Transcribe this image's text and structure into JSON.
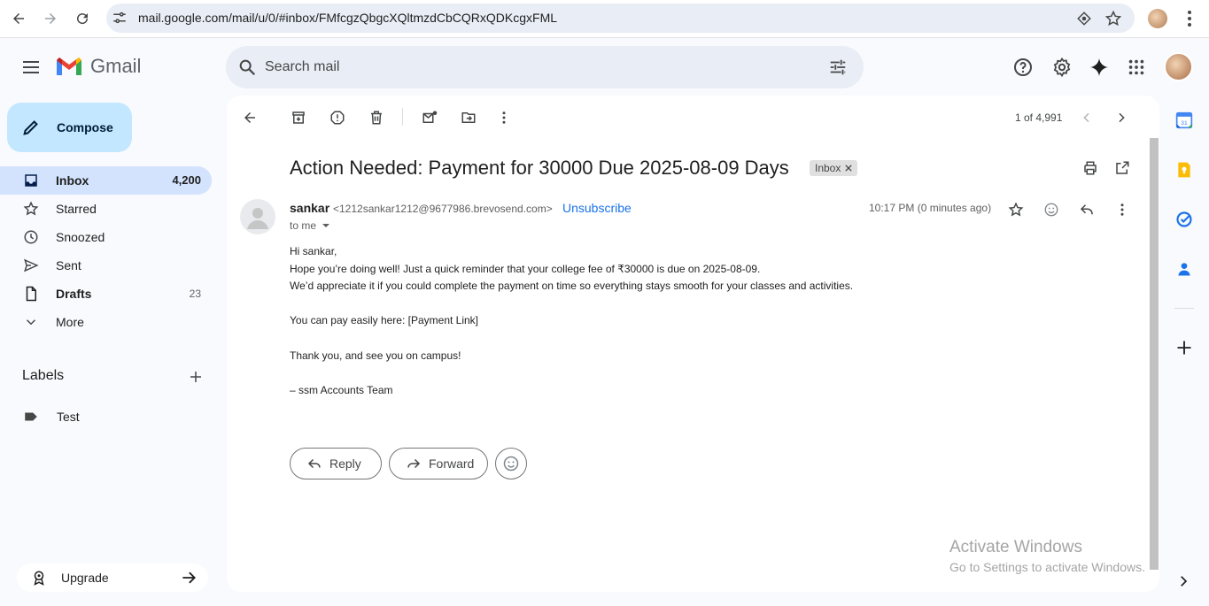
{
  "browser": {
    "url": "mail.google.com/mail/u/0/#inbox/FMfcgzQbgcXQltmzdCbCQRxQDKcgxFML"
  },
  "app": {
    "name": "Gmail"
  },
  "search": {
    "placeholder": "Search mail"
  },
  "compose_label": "Compose",
  "nav": [
    {
      "label": "Inbox",
      "count": "4,200",
      "icon": "inbox-icon"
    },
    {
      "label": "Starred",
      "count": "",
      "icon": "star-icon"
    },
    {
      "label": "Snoozed",
      "count": "",
      "icon": "clock-icon"
    },
    {
      "label": "Sent",
      "count": "",
      "icon": "send-icon"
    },
    {
      "label": "Drafts",
      "count": "23",
      "icon": "draft-icon"
    },
    {
      "label": "More",
      "count": "",
      "icon": "chevron-down-icon"
    }
  ],
  "labels": {
    "title": "Labels",
    "items": [
      "Test"
    ]
  },
  "upgrade_label": "Upgrade",
  "pager": "1 of 4,991",
  "email": {
    "subject": "Action Needed: Payment for 30000 Due 2025-08-09 Days",
    "tag": "Inbox",
    "sender_name": "sankar",
    "sender_email": "<1212sankar1212@9677986.brevosend.com>",
    "unsubscribe": "Unsubscribe",
    "to": "to me",
    "time": "10:17 PM (0 minutes ago)",
    "body": [
      "Hi sankar,",
      "Hope you’re doing well! Just a quick reminder that your college fee of ₹30000 is due on 2025-08-09.",
      "We’d appreciate it if you could complete the payment on time so everything stays smooth for your classes and activities.",
      "",
      "You can pay easily here: [Payment Link]",
      "",
      "Thank you, and see you on campus!",
      "",
      "– ssm Accounts Team"
    ]
  },
  "actions": {
    "reply": "Reply",
    "forward": "Forward"
  },
  "watermark": {
    "line1": "Activate Windows",
    "line2": "Go to Settings to activate Windows."
  },
  "colors": {
    "accent": "#1a73e8",
    "active_nav": "#d3e3fd",
    "compose": "#c2e7ff"
  }
}
